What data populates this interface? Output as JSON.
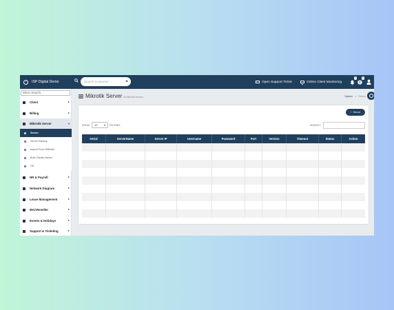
{
  "topbar": {
    "brand_name": "ISP Digital Demo",
    "customer_search_placeholder": "Search Customer",
    "open_ticket_label": "Open Support Ticket",
    "monitoring_label": "Online Client Monitoring",
    "notification_count": "0",
    "alert_count": "1"
  },
  "sidebar": {
    "menu_search_placeholder": "Menu Search...",
    "items": [
      {
        "label": "Client"
      },
      {
        "label": "Billing"
      },
      {
        "label": "Mikrotik Server"
      },
      {
        "label": "HR & Payroll"
      },
      {
        "label": "Network Diagram"
      },
      {
        "label": "Leave Management"
      },
      {
        "label": "MACReseller"
      },
      {
        "label": "Events & Holidays"
      },
      {
        "label": "Support & Ticketing"
      }
    ],
    "submenu": [
      {
        "label": "Server"
      },
      {
        "label": "Server Backup"
      },
      {
        "label": "Import From Mikrotik"
      },
      {
        "label": "Bulk Clients Import"
      },
      {
        "label": "Olt"
      }
    ]
  },
  "page": {
    "title": "Mikrotik Server",
    "subtitle": "All Mikrotik Servers",
    "breadcrumb": [
      "System",
      "Server"
    ],
    "breadcrumb_sep": ">",
    "add_button_label": "Server",
    "add_button_prefix": "+"
  },
  "table": {
    "show_label": "SHOW",
    "length_value": "10",
    "entries_label": "ENTRIES",
    "search_label": "SEARCH:",
    "columns": [
      "Serial",
      "ServerName",
      "Server IP",
      "Username",
      "Password",
      "Port",
      "Version",
      "Timeout",
      "Status",
      "Action"
    ]
  },
  "colors": {
    "primary": "#1f3f5c",
    "selected_menu_bg": "#dfe6ee"
  },
  "icons": {
    "logo": "logo-circle-icon",
    "search": "search-icon",
    "ticket": "ticket-icon",
    "monitor": "monitor-icon",
    "bell": "bell-icon",
    "alert": "alert-icon",
    "user": "user-icon",
    "gear": "gear-icon",
    "list": "list-icon"
  }
}
